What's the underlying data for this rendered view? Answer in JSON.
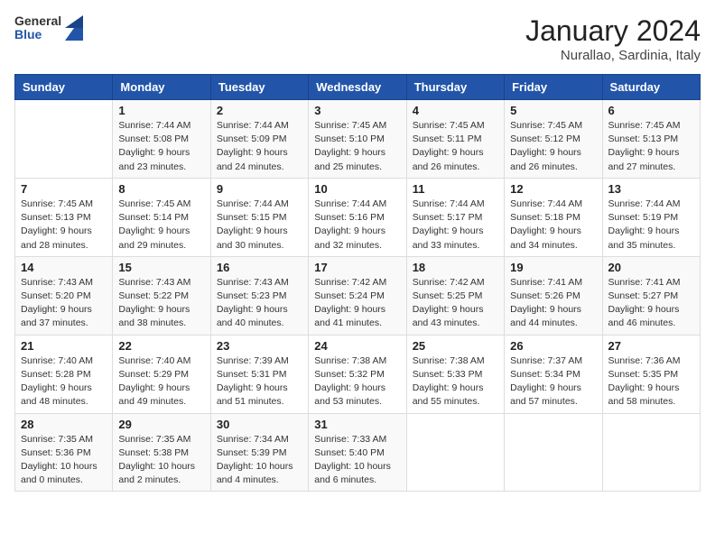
{
  "header": {
    "logo_general": "General",
    "logo_blue": "Blue",
    "month_title": "January 2024",
    "location": "Nurallao, Sardinia, Italy"
  },
  "weekdays": [
    "Sunday",
    "Monday",
    "Tuesday",
    "Wednesday",
    "Thursday",
    "Friday",
    "Saturday"
  ],
  "weeks": [
    [
      {
        "day": "",
        "sunrise": "",
        "sunset": "",
        "daylight": ""
      },
      {
        "day": "1",
        "sunrise": "Sunrise: 7:44 AM",
        "sunset": "Sunset: 5:08 PM",
        "daylight": "Daylight: 9 hours and 23 minutes."
      },
      {
        "day": "2",
        "sunrise": "Sunrise: 7:44 AM",
        "sunset": "Sunset: 5:09 PM",
        "daylight": "Daylight: 9 hours and 24 minutes."
      },
      {
        "day": "3",
        "sunrise": "Sunrise: 7:45 AM",
        "sunset": "Sunset: 5:10 PM",
        "daylight": "Daylight: 9 hours and 25 minutes."
      },
      {
        "day": "4",
        "sunrise": "Sunrise: 7:45 AM",
        "sunset": "Sunset: 5:11 PM",
        "daylight": "Daylight: 9 hours and 26 minutes."
      },
      {
        "day": "5",
        "sunrise": "Sunrise: 7:45 AM",
        "sunset": "Sunset: 5:12 PM",
        "daylight": "Daylight: 9 hours and 26 minutes."
      },
      {
        "day": "6",
        "sunrise": "Sunrise: 7:45 AM",
        "sunset": "Sunset: 5:13 PM",
        "daylight": "Daylight: 9 hours and 27 minutes."
      }
    ],
    [
      {
        "day": "7",
        "sunrise": "Sunrise: 7:45 AM",
        "sunset": "Sunset: 5:13 PM",
        "daylight": "Daylight: 9 hours and 28 minutes."
      },
      {
        "day": "8",
        "sunrise": "Sunrise: 7:45 AM",
        "sunset": "Sunset: 5:14 PM",
        "daylight": "Daylight: 9 hours and 29 minutes."
      },
      {
        "day": "9",
        "sunrise": "Sunrise: 7:44 AM",
        "sunset": "Sunset: 5:15 PM",
        "daylight": "Daylight: 9 hours and 30 minutes."
      },
      {
        "day": "10",
        "sunrise": "Sunrise: 7:44 AM",
        "sunset": "Sunset: 5:16 PM",
        "daylight": "Daylight: 9 hours and 32 minutes."
      },
      {
        "day": "11",
        "sunrise": "Sunrise: 7:44 AM",
        "sunset": "Sunset: 5:17 PM",
        "daylight": "Daylight: 9 hours and 33 minutes."
      },
      {
        "day": "12",
        "sunrise": "Sunrise: 7:44 AM",
        "sunset": "Sunset: 5:18 PM",
        "daylight": "Daylight: 9 hours and 34 minutes."
      },
      {
        "day": "13",
        "sunrise": "Sunrise: 7:44 AM",
        "sunset": "Sunset: 5:19 PM",
        "daylight": "Daylight: 9 hours and 35 minutes."
      }
    ],
    [
      {
        "day": "14",
        "sunrise": "Sunrise: 7:43 AM",
        "sunset": "Sunset: 5:20 PM",
        "daylight": "Daylight: 9 hours and 37 minutes."
      },
      {
        "day": "15",
        "sunrise": "Sunrise: 7:43 AM",
        "sunset": "Sunset: 5:22 PM",
        "daylight": "Daylight: 9 hours and 38 minutes."
      },
      {
        "day": "16",
        "sunrise": "Sunrise: 7:43 AM",
        "sunset": "Sunset: 5:23 PM",
        "daylight": "Daylight: 9 hours and 40 minutes."
      },
      {
        "day": "17",
        "sunrise": "Sunrise: 7:42 AM",
        "sunset": "Sunset: 5:24 PM",
        "daylight": "Daylight: 9 hours and 41 minutes."
      },
      {
        "day": "18",
        "sunrise": "Sunrise: 7:42 AM",
        "sunset": "Sunset: 5:25 PM",
        "daylight": "Daylight: 9 hours and 43 minutes."
      },
      {
        "day": "19",
        "sunrise": "Sunrise: 7:41 AM",
        "sunset": "Sunset: 5:26 PM",
        "daylight": "Daylight: 9 hours and 44 minutes."
      },
      {
        "day": "20",
        "sunrise": "Sunrise: 7:41 AM",
        "sunset": "Sunset: 5:27 PM",
        "daylight": "Daylight: 9 hours and 46 minutes."
      }
    ],
    [
      {
        "day": "21",
        "sunrise": "Sunrise: 7:40 AM",
        "sunset": "Sunset: 5:28 PM",
        "daylight": "Daylight: 9 hours and 48 minutes."
      },
      {
        "day": "22",
        "sunrise": "Sunrise: 7:40 AM",
        "sunset": "Sunset: 5:29 PM",
        "daylight": "Daylight: 9 hours and 49 minutes."
      },
      {
        "day": "23",
        "sunrise": "Sunrise: 7:39 AM",
        "sunset": "Sunset: 5:31 PM",
        "daylight": "Daylight: 9 hours and 51 minutes."
      },
      {
        "day": "24",
        "sunrise": "Sunrise: 7:38 AM",
        "sunset": "Sunset: 5:32 PM",
        "daylight": "Daylight: 9 hours and 53 minutes."
      },
      {
        "day": "25",
        "sunrise": "Sunrise: 7:38 AM",
        "sunset": "Sunset: 5:33 PM",
        "daylight": "Daylight: 9 hours and 55 minutes."
      },
      {
        "day": "26",
        "sunrise": "Sunrise: 7:37 AM",
        "sunset": "Sunset: 5:34 PM",
        "daylight": "Daylight: 9 hours and 57 minutes."
      },
      {
        "day": "27",
        "sunrise": "Sunrise: 7:36 AM",
        "sunset": "Sunset: 5:35 PM",
        "daylight": "Daylight: 9 hours and 58 minutes."
      }
    ],
    [
      {
        "day": "28",
        "sunrise": "Sunrise: 7:35 AM",
        "sunset": "Sunset: 5:36 PM",
        "daylight": "Daylight: 10 hours and 0 minutes."
      },
      {
        "day": "29",
        "sunrise": "Sunrise: 7:35 AM",
        "sunset": "Sunset: 5:38 PM",
        "daylight": "Daylight: 10 hours and 2 minutes."
      },
      {
        "day": "30",
        "sunrise": "Sunrise: 7:34 AM",
        "sunset": "Sunset: 5:39 PM",
        "daylight": "Daylight: 10 hours and 4 minutes."
      },
      {
        "day": "31",
        "sunrise": "Sunrise: 7:33 AM",
        "sunset": "Sunset: 5:40 PM",
        "daylight": "Daylight: 10 hours and 6 minutes."
      },
      {
        "day": "",
        "sunrise": "",
        "sunset": "",
        "daylight": ""
      },
      {
        "day": "",
        "sunrise": "",
        "sunset": "",
        "daylight": ""
      },
      {
        "day": "",
        "sunrise": "",
        "sunset": "",
        "daylight": ""
      }
    ]
  ]
}
